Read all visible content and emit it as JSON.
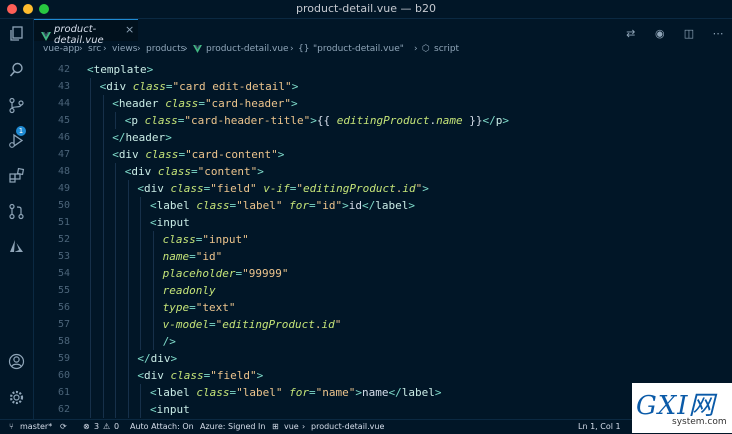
{
  "window": {
    "title": "product-detail.vue — b20"
  },
  "tab": {
    "label": "product-detail.vue",
    "close": "×"
  },
  "breadcrumb": {
    "items": [
      "vue-app",
      "src",
      "views",
      "products",
      "product-detail.vue",
      "\"product-detail.vue\"",
      "script"
    ],
    "braces": "{}"
  },
  "activity": {
    "scm_badge": "1"
  },
  "lines": [
    {
      "n": "42",
      "indent": 0,
      "tokens": [
        [
          "p",
          "<"
        ],
        [
          "t",
          "template"
        ],
        [
          "p",
          ">"
        ]
      ]
    },
    {
      "n": "43",
      "indent": 1,
      "tokens": [
        [
          "p",
          "<"
        ],
        [
          "t",
          "div"
        ],
        [
          "d",
          " "
        ],
        [
          "a",
          "class"
        ],
        [
          "p",
          "="
        ],
        [
          "s",
          "\"card edit-detail\""
        ],
        [
          "p",
          ">"
        ]
      ]
    },
    {
      "n": "44",
      "indent": 2,
      "tokens": [
        [
          "p",
          "<"
        ],
        [
          "t",
          "header"
        ],
        [
          "d",
          " "
        ],
        [
          "a",
          "class"
        ],
        [
          "p",
          "="
        ],
        [
          "s",
          "\"card-header\""
        ],
        [
          "p",
          ">"
        ]
      ]
    },
    {
      "n": "45",
      "indent": 3,
      "tokens": [
        [
          "p",
          "<"
        ],
        [
          "t",
          "p"
        ],
        [
          "d",
          " "
        ],
        [
          "a",
          "class"
        ],
        [
          "p",
          "="
        ],
        [
          "s",
          "\"card-header-title\""
        ],
        [
          "p",
          ">"
        ],
        [
          "d",
          "{{ "
        ],
        [
          "v",
          "editingProduct"
        ],
        [
          "d",
          "."
        ],
        [
          "v",
          "name"
        ],
        [
          "d",
          " }}"
        ],
        [
          "p",
          "</"
        ],
        [
          "t",
          "p"
        ],
        [
          "p",
          ">"
        ]
      ]
    },
    {
      "n": "46",
      "indent": 2,
      "tokens": [
        [
          "p",
          "</"
        ],
        [
          "t",
          "header"
        ],
        [
          "p",
          ">"
        ]
      ]
    },
    {
      "n": "47",
      "indent": 2,
      "tokens": [
        [
          "p",
          "<"
        ],
        [
          "t",
          "div"
        ],
        [
          "d",
          " "
        ],
        [
          "a",
          "class"
        ],
        [
          "p",
          "="
        ],
        [
          "s",
          "\"card-content\""
        ],
        [
          "p",
          ">"
        ]
      ]
    },
    {
      "n": "48",
      "indent": 3,
      "tokens": [
        [
          "p",
          "<"
        ],
        [
          "t",
          "div"
        ],
        [
          "d",
          " "
        ],
        [
          "a",
          "class"
        ],
        [
          "p",
          "="
        ],
        [
          "s",
          "\"content\""
        ],
        [
          "p",
          ">"
        ]
      ]
    },
    {
      "n": "49",
      "indent": 4,
      "tokens": [
        [
          "p",
          "<"
        ],
        [
          "t",
          "div"
        ],
        [
          "d",
          " "
        ],
        [
          "a",
          "class"
        ],
        [
          "p",
          "="
        ],
        [
          "s",
          "\"field\""
        ],
        [
          "d",
          " "
        ],
        [
          "a",
          "v-if"
        ],
        [
          "p",
          "="
        ],
        [
          "s",
          "\""
        ],
        [
          "v",
          "editingProduct"
        ],
        [
          "s",
          "."
        ],
        [
          "v",
          "id"
        ],
        [
          "s",
          "\""
        ],
        [
          "p",
          ">"
        ]
      ]
    },
    {
      "n": "50",
      "indent": 5,
      "tokens": [
        [
          "p",
          "<"
        ],
        [
          "t",
          "label"
        ],
        [
          "d",
          " "
        ],
        [
          "a",
          "class"
        ],
        [
          "p",
          "="
        ],
        [
          "s",
          "\"label\""
        ],
        [
          "d",
          " "
        ],
        [
          "a",
          "for"
        ],
        [
          "p",
          "="
        ],
        [
          "s",
          "\"id\""
        ],
        [
          "p",
          ">"
        ],
        [
          "d",
          "id"
        ],
        [
          "p",
          "</"
        ],
        [
          "t",
          "label"
        ],
        [
          "p",
          ">"
        ]
      ]
    },
    {
      "n": "51",
      "indent": 5,
      "tokens": [
        [
          "p",
          "<"
        ],
        [
          "t",
          "input"
        ]
      ]
    },
    {
      "n": "52",
      "indent": 6,
      "tokens": [
        [
          "a",
          "class"
        ],
        [
          "p",
          "="
        ],
        [
          "s",
          "\"input\""
        ]
      ]
    },
    {
      "n": "53",
      "indent": 6,
      "tokens": [
        [
          "a",
          "name"
        ],
        [
          "p",
          "="
        ],
        [
          "s",
          "\"id\""
        ]
      ]
    },
    {
      "n": "54",
      "indent": 6,
      "tokens": [
        [
          "a",
          "placeholder"
        ],
        [
          "p",
          "="
        ],
        [
          "s",
          "\"99999\""
        ]
      ]
    },
    {
      "n": "55",
      "indent": 6,
      "tokens": [
        [
          "a",
          "readonly"
        ]
      ]
    },
    {
      "n": "56",
      "indent": 6,
      "tokens": [
        [
          "a",
          "type"
        ],
        [
          "p",
          "="
        ],
        [
          "s",
          "\"text\""
        ]
      ]
    },
    {
      "n": "57",
      "indent": 6,
      "tokens": [
        [
          "a",
          "v-model"
        ],
        [
          "p",
          "="
        ],
        [
          "s",
          "\""
        ],
        [
          "v",
          "editingProduct"
        ],
        [
          "s",
          "."
        ],
        [
          "v",
          "id"
        ],
        [
          "s",
          "\""
        ]
      ]
    },
    {
      "n": "58",
      "indent": 6,
      "tokens": [
        [
          "p",
          "/>"
        ]
      ]
    },
    {
      "n": "59",
      "indent": 4,
      "tokens": [
        [
          "p",
          "</"
        ],
        [
          "t",
          "div"
        ],
        [
          "p",
          ">"
        ]
      ]
    },
    {
      "n": "60",
      "indent": 4,
      "tokens": [
        [
          "p",
          "<"
        ],
        [
          "t",
          "div"
        ],
        [
          "d",
          " "
        ],
        [
          "a",
          "class"
        ],
        [
          "p",
          "="
        ],
        [
          "s",
          "\"field\""
        ],
        [
          "p",
          ">"
        ]
      ]
    },
    {
      "n": "61",
      "indent": 5,
      "tokens": [
        [
          "p",
          "<"
        ],
        [
          "t",
          "label"
        ],
        [
          "d",
          " "
        ],
        [
          "a",
          "class"
        ],
        [
          "p",
          "="
        ],
        [
          "s",
          "\"label\""
        ],
        [
          "d",
          " "
        ],
        [
          "a",
          "for"
        ],
        [
          "p",
          "="
        ],
        [
          "s",
          "\"name\""
        ],
        [
          "p",
          ">"
        ],
        [
          "d",
          "name"
        ],
        [
          "p",
          "</"
        ],
        [
          "t",
          "label"
        ],
        [
          "p",
          ">"
        ]
      ]
    },
    {
      "n": "62",
      "indent": 5,
      "tokens": [
        [
          "p",
          "<"
        ],
        [
          "t",
          "input"
        ]
      ]
    }
  ],
  "colors": {
    "tag": "#caece6",
    "punct": "#7fdbca",
    "attr": "#c5e478",
    "string": "#ecc48d",
    "var": "#c5e478",
    "text": "#d6deeb",
    "accent": "#1f8ad2",
    "bg": "#011627"
  },
  "status": {
    "branch": "master*",
    "problems": "3",
    "warnings": "0",
    "auto_attach": "Auto Attach: On",
    "azure": "Azure: Signed In",
    "language": "vue",
    "file": "product-detail.vue",
    "position": "Ln 1, Col 1"
  },
  "watermark": {
    "big": "GXI网",
    "small": "system.com"
  }
}
